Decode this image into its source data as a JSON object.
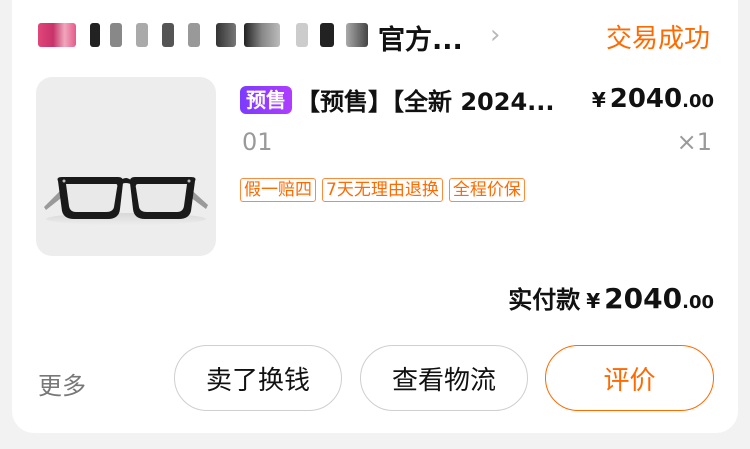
{
  "shop": {
    "name": "官方...",
    "chevron": "chevron-right-icon",
    "status": "交易成功"
  },
  "item": {
    "badge": "预售",
    "title": "【预售】【全新 2024...",
    "price_symbol": "¥",
    "price_main": "2040",
    "price_cents": ".00",
    "sku": "01",
    "quantity": "×1",
    "tags": [
      "假一赔四",
      "7天无理由退换",
      "全程价保"
    ]
  },
  "payment": {
    "label": "实付款",
    "symbol": "¥",
    "main": "2040",
    "cents": ".00"
  },
  "actions": {
    "more": "更多",
    "sell": "卖了换钱",
    "logistics": "查看物流",
    "review": "评价"
  },
  "colors": {
    "accent": "#ff6a00",
    "badge_start": "#7b3bff",
    "badge_end": "#b03cff"
  }
}
